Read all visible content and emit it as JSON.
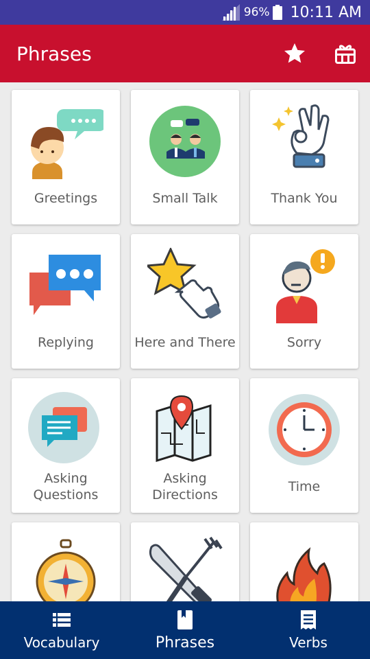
{
  "status": {
    "battery": "96%",
    "time": "10:11 AM"
  },
  "app_bar": {
    "title": "Phrases"
  },
  "categories": [
    {
      "label": "Greetings"
    },
    {
      "label": "Small Talk"
    },
    {
      "label": "Thank You"
    },
    {
      "label": "Replying"
    },
    {
      "label": "Here and There"
    },
    {
      "label": "Sorry"
    },
    {
      "label": "Asking\nQuestions"
    },
    {
      "label": "Asking\nDirections"
    },
    {
      "label": "Time"
    },
    {
      "label": ""
    },
    {
      "label": ""
    },
    {
      "label": ""
    }
  ],
  "bottom_nav": {
    "vocabulary": "Vocabulary",
    "phrases": "Phrases",
    "verbs": "Verbs"
  },
  "colors": {
    "status_bar": "#3f3a9e",
    "app_bar": "#c8102e",
    "bottom_nav": "#023070"
  }
}
